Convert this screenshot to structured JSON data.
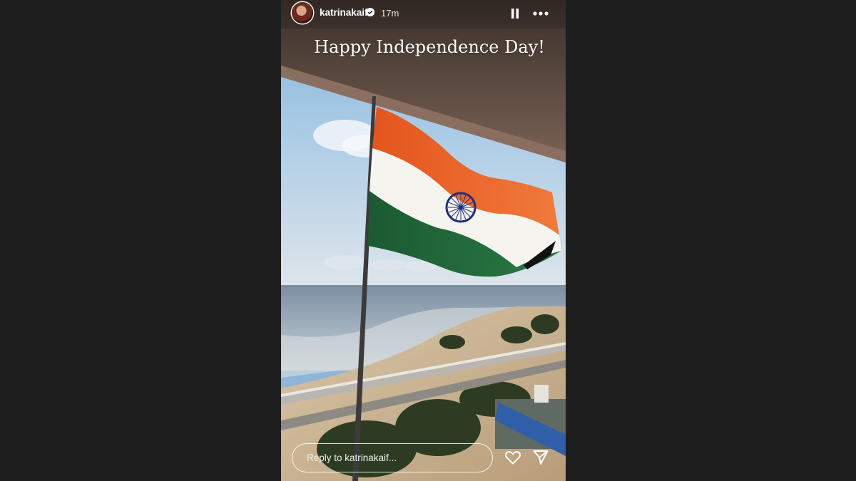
{
  "story": {
    "username": "katrinakaif",
    "time_ago": "17m",
    "caption": "Happy Independence Day!",
    "reply_placeholder": "Reply to katrinakaif...",
    "verified": true
  },
  "icons": {
    "pause": "pause-icon",
    "more": "more-icon",
    "heart": "heart-icon",
    "send": "send-icon",
    "verified": "verified-badge-icon"
  },
  "colors": {
    "background": "#1e1e1e",
    "saffron": "#f26a2a",
    "flag_white": "#f7f5f0",
    "flag_green": "#1f6b3a",
    "chakra_blue": "#1d2f7a"
  }
}
